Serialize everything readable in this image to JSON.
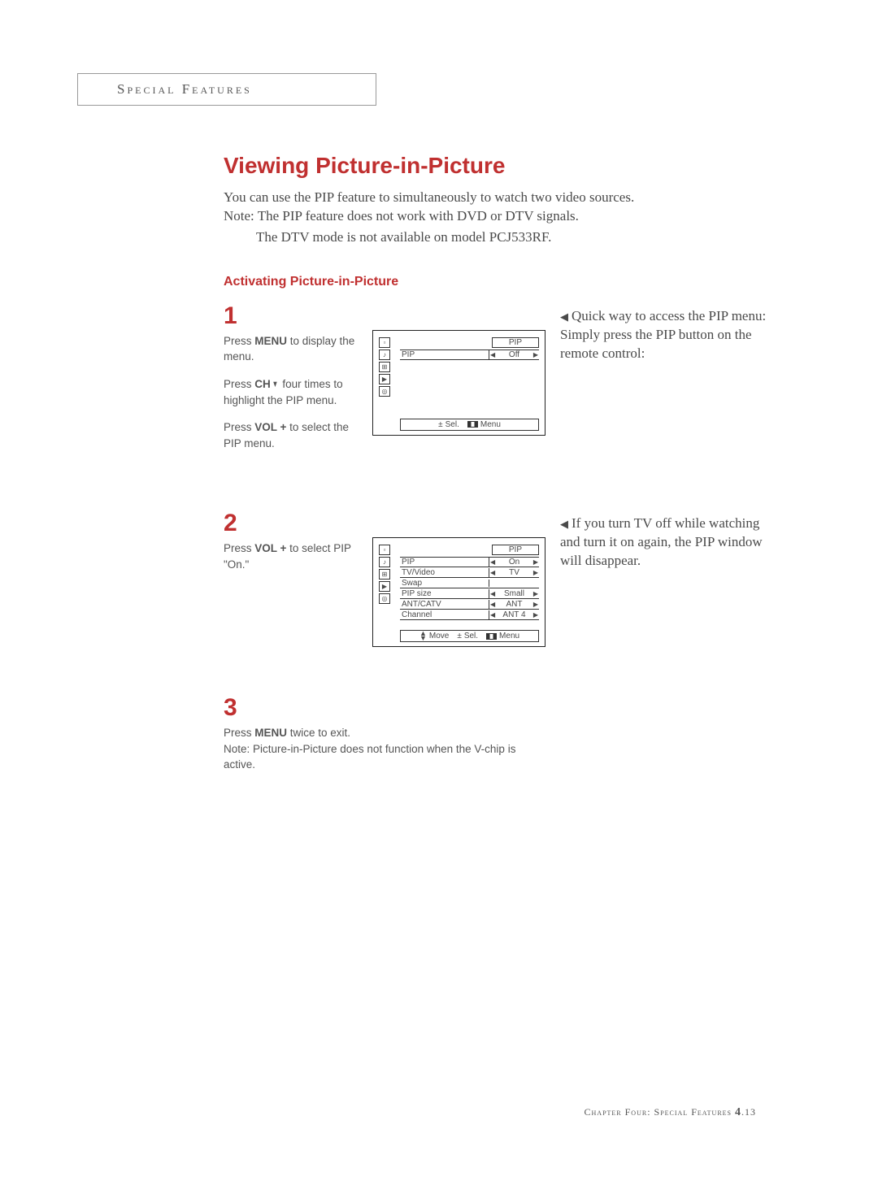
{
  "header": {
    "title": "Special Features"
  },
  "main": {
    "title": "Viewing Picture-in-Picture",
    "intro_line1": "You can use the PIP feature to simultaneously to watch two video sources.",
    "intro_line2": "Note: The PIP feature does not work with DVD or DTV signals.",
    "intro_line3": "The DTV mode is not available on model PCJ533RF.",
    "subhead": "Activating Picture-in-Picture"
  },
  "steps": {
    "s1": {
      "num": "1",
      "p1a": "Press ",
      "p1b": "MENU",
      "p1c": " to display the menu.",
      "p2a": "Press ",
      "p2b": "CH",
      "p2c": " four times to highlight the PIP menu.",
      "p3a": "Press ",
      "p3b": "VOL +",
      "p3c": " to select the PIP menu."
    },
    "s2": {
      "num": "2",
      "p1a": "Press ",
      "p1b": "VOL +",
      "p1c": " to select PIP \"On.\""
    },
    "s3": {
      "num": "3",
      "p1a": "Press ",
      "p1b": "MENU",
      "p1c": " twice to exit.",
      "p2": "Note: Picture-in-Picture does not function when the V-chip is active."
    }
  },
  "osd1": {
    "title": "PIP",
    "rows": [
      {
        "label": "PIP",
        "value": "Off",
        "arrows": true
      }
    ],
    "footer": {
      "sel_sym": "±",
      "sel": "Sel.",
      "menu": "Menu"
    }
  },
  "osd2": {
    "title": "PIP",
    "rows": [
      {
        "label": "PIP",
        "value": "On",
        "arrows": true
      },
      {
        "label": "TV/Video",
        "value": "TV",
        "arrows": true
      },
      {
        "label": "Swap",
        "value": "",
        "arrows": false
      },
      {
        "label": "PIP size",
        "value": "Small",
        "arrows": true
      },
      {
        "label": "ANT/CATV",
        "value": "ANT",
        "arrows": true
      },
      {
        "label": "Channel",
        "value": "ANT 4",
        "arrows": true
      }
    ],
    "footer": {
      "move": "Move",
      "sel_sym": "±",
      "sel": "Sel.",
      "menu": "Menu"
    }
  },
  "notes": {
    "n1": "Quick way to access the PIP menu: Simply press the PIP button on the remote control:",
    "n2": "If you turn TV off while watching and turn it on again, the PIP window will disappear."
  },
  "footer": {
    "chapter": "Chapter Four: Special Features",
    "pagenum": "4",
    "pagesub": ".13"
  }
}
